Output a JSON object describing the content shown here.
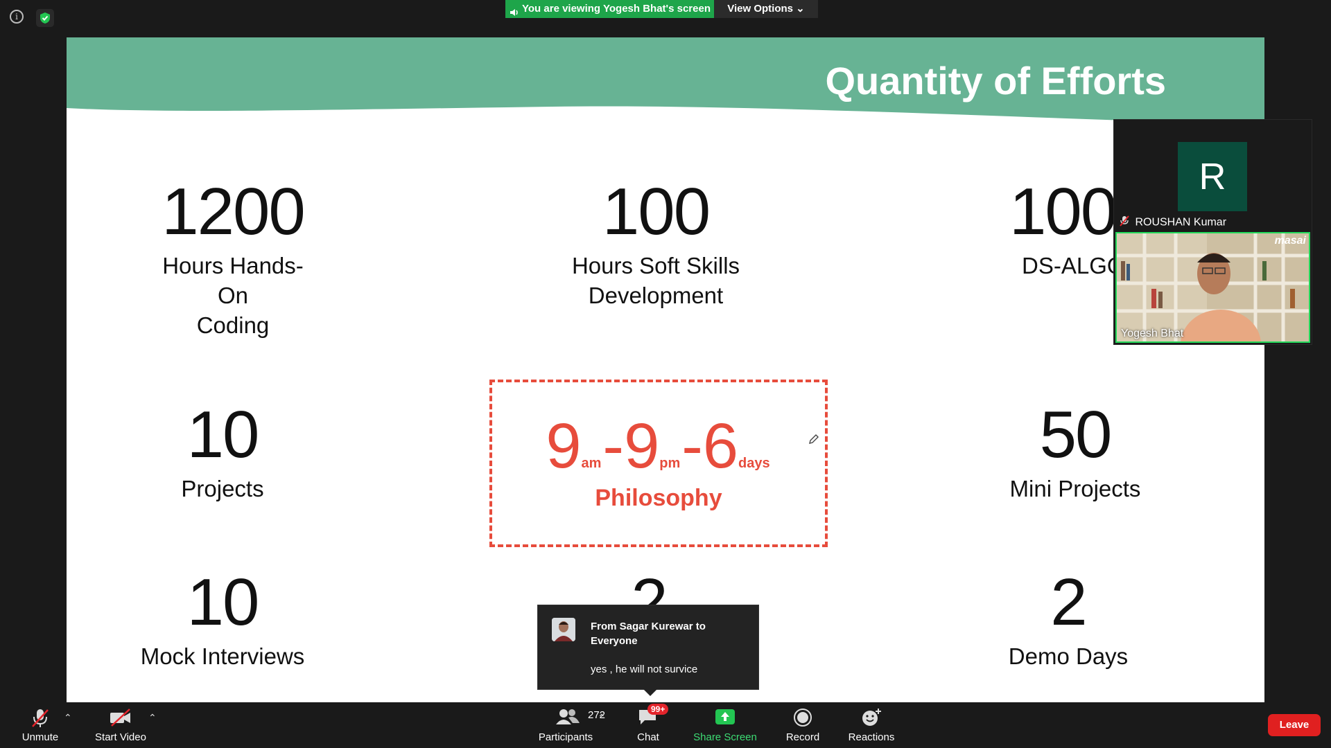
{
  "banner": {
    "viewing_text": "You are viewing Yogesh Bhat's screen",
    "view_options_label": "View Options"
  },
  "slide": {
    "title": "Quantity of Efforts",
    "stats": [
      {
        "num": "1200",
        "label_line1": "Hours Hands-On",
        "label_line2": "Coding"
      },
      {
        "num": "100",
        "label_line1": "Hours Soft Skills",
        "label_line2": "Development"
      },
      {
        "num": "100",
        "label_line1": "DS-ALGO",
        "label_line2": ""
      },
      {
        "num": "10",
        "label_line1": "Projects",
        "label_line2": ""
      },
      {
        "num": "50",
        "label_line1": "Mini Projects",
        "label_line2": ""
      },
      {
        "num": "10",
        "label_line1": "Mock Interviews",
        "label_line2": ""
      },
      {
        "num": "2",
        "label_line1": "",
        "label_line2": ""
      },
      {
        "num": "2",
        "label_line1": "Demo Days",
        "label_line2": ""
      }
    ],
    "philosophy": {
      "n1": "9",
      "s1": "am",
      "n2": "9",
      "s2": "pm",
      "n3": "6",
      "s3": "days",
      "dash": "-",
      "label": "Philosophy"
    },
    "header_color": "#67b394",
    "accent_color": "#e74c3c"
  },
  "participants_panel": {
    "avatar_letter": "R",
    "roushan_name": "ROUSHAN Kumar",
    "yogesh_name": "Yogesh Bhat",
    "masai_logo": "masai"
  },
  "chat_popup": {
    "from": "From Sagar Kurewar to Everyone",
    "message": "yes , he will not survice"
  },
  "toolbar": {
    "unmute": "Unmute",
    "start_video": "Start Video",
    "participants": "Participants",
    "participant_count": "272",
    "chat": "Chat",
    "chat_badge": "99+",
    "share_screen": "Share Screen",
    "record": "Record",
    "reactions": "Reactions",
    "leave": "Leave",
    "share_color": "#3ddc74"
  }
}
